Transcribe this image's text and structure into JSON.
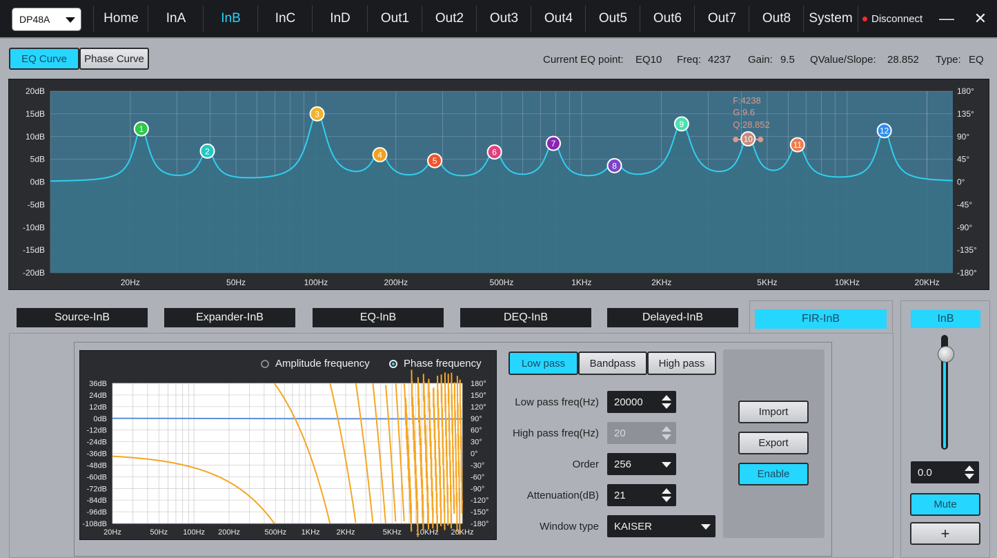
{
  "device": {
    "selected": "DP48A"
  },
  "nav": {
    "tabs": [
      "Home",
      "InA",
      "InB",
      "InC",
      "InD",
      "Out1",
      "Out2",
      "Out3",
      "Out4",
      "Out5",
      "Out6",
      "Out7",
      "Out8",
      "System"
    ],
    "active": "InB",
    "disconnect_label": "Disconnect"
  },
  "window": {
    "minimize": "—",
    "close": "✕"
  },
  "curve_toggle": {
    "eq_label": "EQ Curve",
    "phase_label": "Phase Curve",
    "active": "EQ Curve"
  },
  "eq_info": {
    "point_label": "Current EQ point:",
    "point_value": "EQ10",
    "freq_label": "Freq:",
    "freq_value": "4237",
    "gain_label": "Gain:",
    "gain_value": "9.5",
    "q_label": "QValue/Slope:",
    "q_value": "28.852",
    "type_label": "Type:",
    "type_value": "EQ"
  },
  "eq_chart": {
    "y_left": [
      "20dB",
      "15dB",
      "10dB",
      "5dB",
      "0dB",
      "-5dB",
      "-10dB",
      "-15dB",
      "-20dB"
    ],
    "y_right": [
      "180°",
      "135°",
      "90°",
      "45°",
      "0°",
      "-45°",
      "-90°",
      "-135°",
      "-180°"
    ],
    "x_labels": [
      "20Hz",
      "50Hz",
      "100Hz",
      "200Hz",
      "500Hz",
      "1KHz",
      "2KHz",
      "5KHz",
      "10KHz",
      "20KHz"
    ],
    "tooltip": {
      "f": "F:4238",
      "g": "G:9.6",
      "q": "Q:28.852"
    },
    "points": [
      {
        "n": "1",
        "freq": 22,
        "gain": 11.7,
        "color": "#2fc94a"
      },
      {
        "n": "2",
        "freq": 39,
        "gain": 6.8,
        "color": "#22c8c4"
      },
      {
        "n": "3",
        "freq": 101,
        "gain": 15.0,
        "color": "#f2b22a"
      },
      {
        "n": "4",
        "freq": 174,
        "gain": 6.0,
        "color": "#f2a020"
      },
      {
        "n": "5",
        "freq": 280,
        "gain": 4.7,
        "color": "#f0542a"
      },
      {
        "n": "6",
        "freq": 470,
        "gain": 6.6,
        "color": "#e0407f"
      },
      {
        "n": "7",
        "freq": 783,
        "gain": 8.5,
        "color": "#8a26b0"
      },
      {
        "n": "8",
        "freq": 1330,
        "gain": 3.6,
        "color": "#7c44c8"
      },
      {
        "n": "9",
        "freq": 2380,
        "gain": 12.8,
        "color": "#4de0b0"
      },
      {
        "n": "10",
        "freq": 4237,
        "gain": 9.5,
        "color": "#c98a7a"
      },
      {
        "n": "11",
        "freq": 6500,
        "gain": 8.2,
        "color": "#f07b4a"
      },
      {
        "n": "12",
        "freq": 13800,
        "gain": 11.3,
        "color": "#2d8ef0"
      }
    ]
  },
  "modules": [
    "Source-InB",
    "Expander-InB",
    "EQ-InB",
    "DEQ-InB",
    "Delayed-InB",
    "FIR-InB"
  ],
  "active_module": "FIR-InB",
  "fir": {
    "radio_amplitude": "Amplitude frequency",
    "radio_phase": "Phase frequency",
    "selected_radio": "Phase frequency",
    "y_left": [
      "36dB",
      "24dB",
      "12dB",
      "0dB",
      "-12dB",
      "-24dB",
      "-36dB",
      "-48dB",
      "-60dB",
      "-72dB",
      "-84dB",
      "-96dB",
      "-108dB"
    ],
    "y_right": [
      "180°",
      "150°",
      "120°",
      "90°",
      "60°",
      "30°",
      "0°",
      "-30°",
      "-60°",
      "-90°",
      "-120°",
      "-150°",
      "-180°"
    ],
    "x_labels": [
      "20Hz",
      "50Hz",
      "100Hz",
      "200Hz",
      "500Hz",
      "1KHz",
      "2KHz",
      "5KHz",
      "10KHz",
      "20KHz"
    ],
    "filter_types": [
      "Low pass",
      "Bandpass",
      "High pass"
    ],
    "active_filter": "Low pass",
    "low_pass_label": "Low pass freq(Hz)",
    "low_pass_value": "20000",
    "high_pass_label": "High pass freq(Hz)",
    "high_pass_value": "20",
    "order_label": "Order",
    "order_value": "256",
    "attenuation_label": "Attenuation(dB)",
    "attenuation_value": "21",
    "window_label": "Window type",
    "window_value": "KAISER",
    "import_label": "Import",
    "export_label": "Export",
    "enable_label": "Enable"
  },
  "strip": {
    "title": "InB",
    "gain_value": "0.0",
    "mute_label": "Mute",
    "plus_label": "+"
  },
  "colors": {
    "accent": "#25d6ff",
    "curve": "#2fd0f0",
    "phase": "#f5a623"
  }
}
